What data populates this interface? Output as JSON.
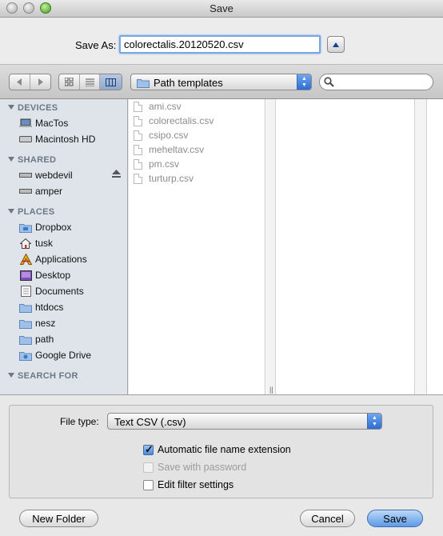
{
  "window": {
    "title": "Save"
  },
  "save_as": {
    "label": "Save As:",
    "value": "colorectalis.20120520.csv"
  },
  "toolbar": {
    "path_popup": "Path templates",
    "search_placeholder": ""
  },
  "sidebar": {
    "devices": {
      "header": "DEVICES",
      "items": [
        {
          "label": "MacTos",
          "icon": "laptop-icon"
        },
        {
          "label": "Macintosh HD",
          "icon": "hard-drive-icon"
        }
      ]
    },
    "shared": {
      "header": "SHARED",
      "items": [
        {
          "label": "webdevil",
          "icon": "network-drive-icon"
        },
        {
          "label": "amper",
          "icon": "network-drive-icon"
        }
      ]
    },
    "places": {
      "header": "PLACES",
      "items": [
        {
          "label": "Dropbox",
          "icon": "folder-icon"
        },
        {
          "label": "tusk",
          "icon": "home-icon"
        },
        {
          "label": "Applications",
          "icon": "applications-icon"
        },
        {
          "label": "Desktop",
          "icon": "desktop-icon"
        },
        {
          "label": "Documents",
          "icon": "documents-icon"
        },
        {
          "label": "htdocs",
          "icon": "folder-icon"
        },
        {
          "label": "nesz",
          "icon": "folder-icon"
        },
        {
          "label": "path",
          "icon": "folder-icon"
        },
        {
          "label": "Google Drive",
          "icon": "folder-icon"
        }
      ]
    },
    "search_for": {
      "header": "SEARCH FOR"
    }
  },
  "files": [
    "ami.csv",
    "colorectalis.csv",
    "csipo.csv",
    "meheltav.csv",
    "pm.csv",
    "turturp.csv"
  ],
  "options": {
    "file_type_label": "File type:",
    "file_type_value": "Text CSV (.csv)",
    "auto_extension": "Automatic file name extension",
    "save_with_password": "Save with password",
    "edit_filter": "Edit filter settings"
  },
  "buttons": {
    "new_folder": "New Folder",
    "cancel": "Cancel",
    "save": "Save"
  }
}
